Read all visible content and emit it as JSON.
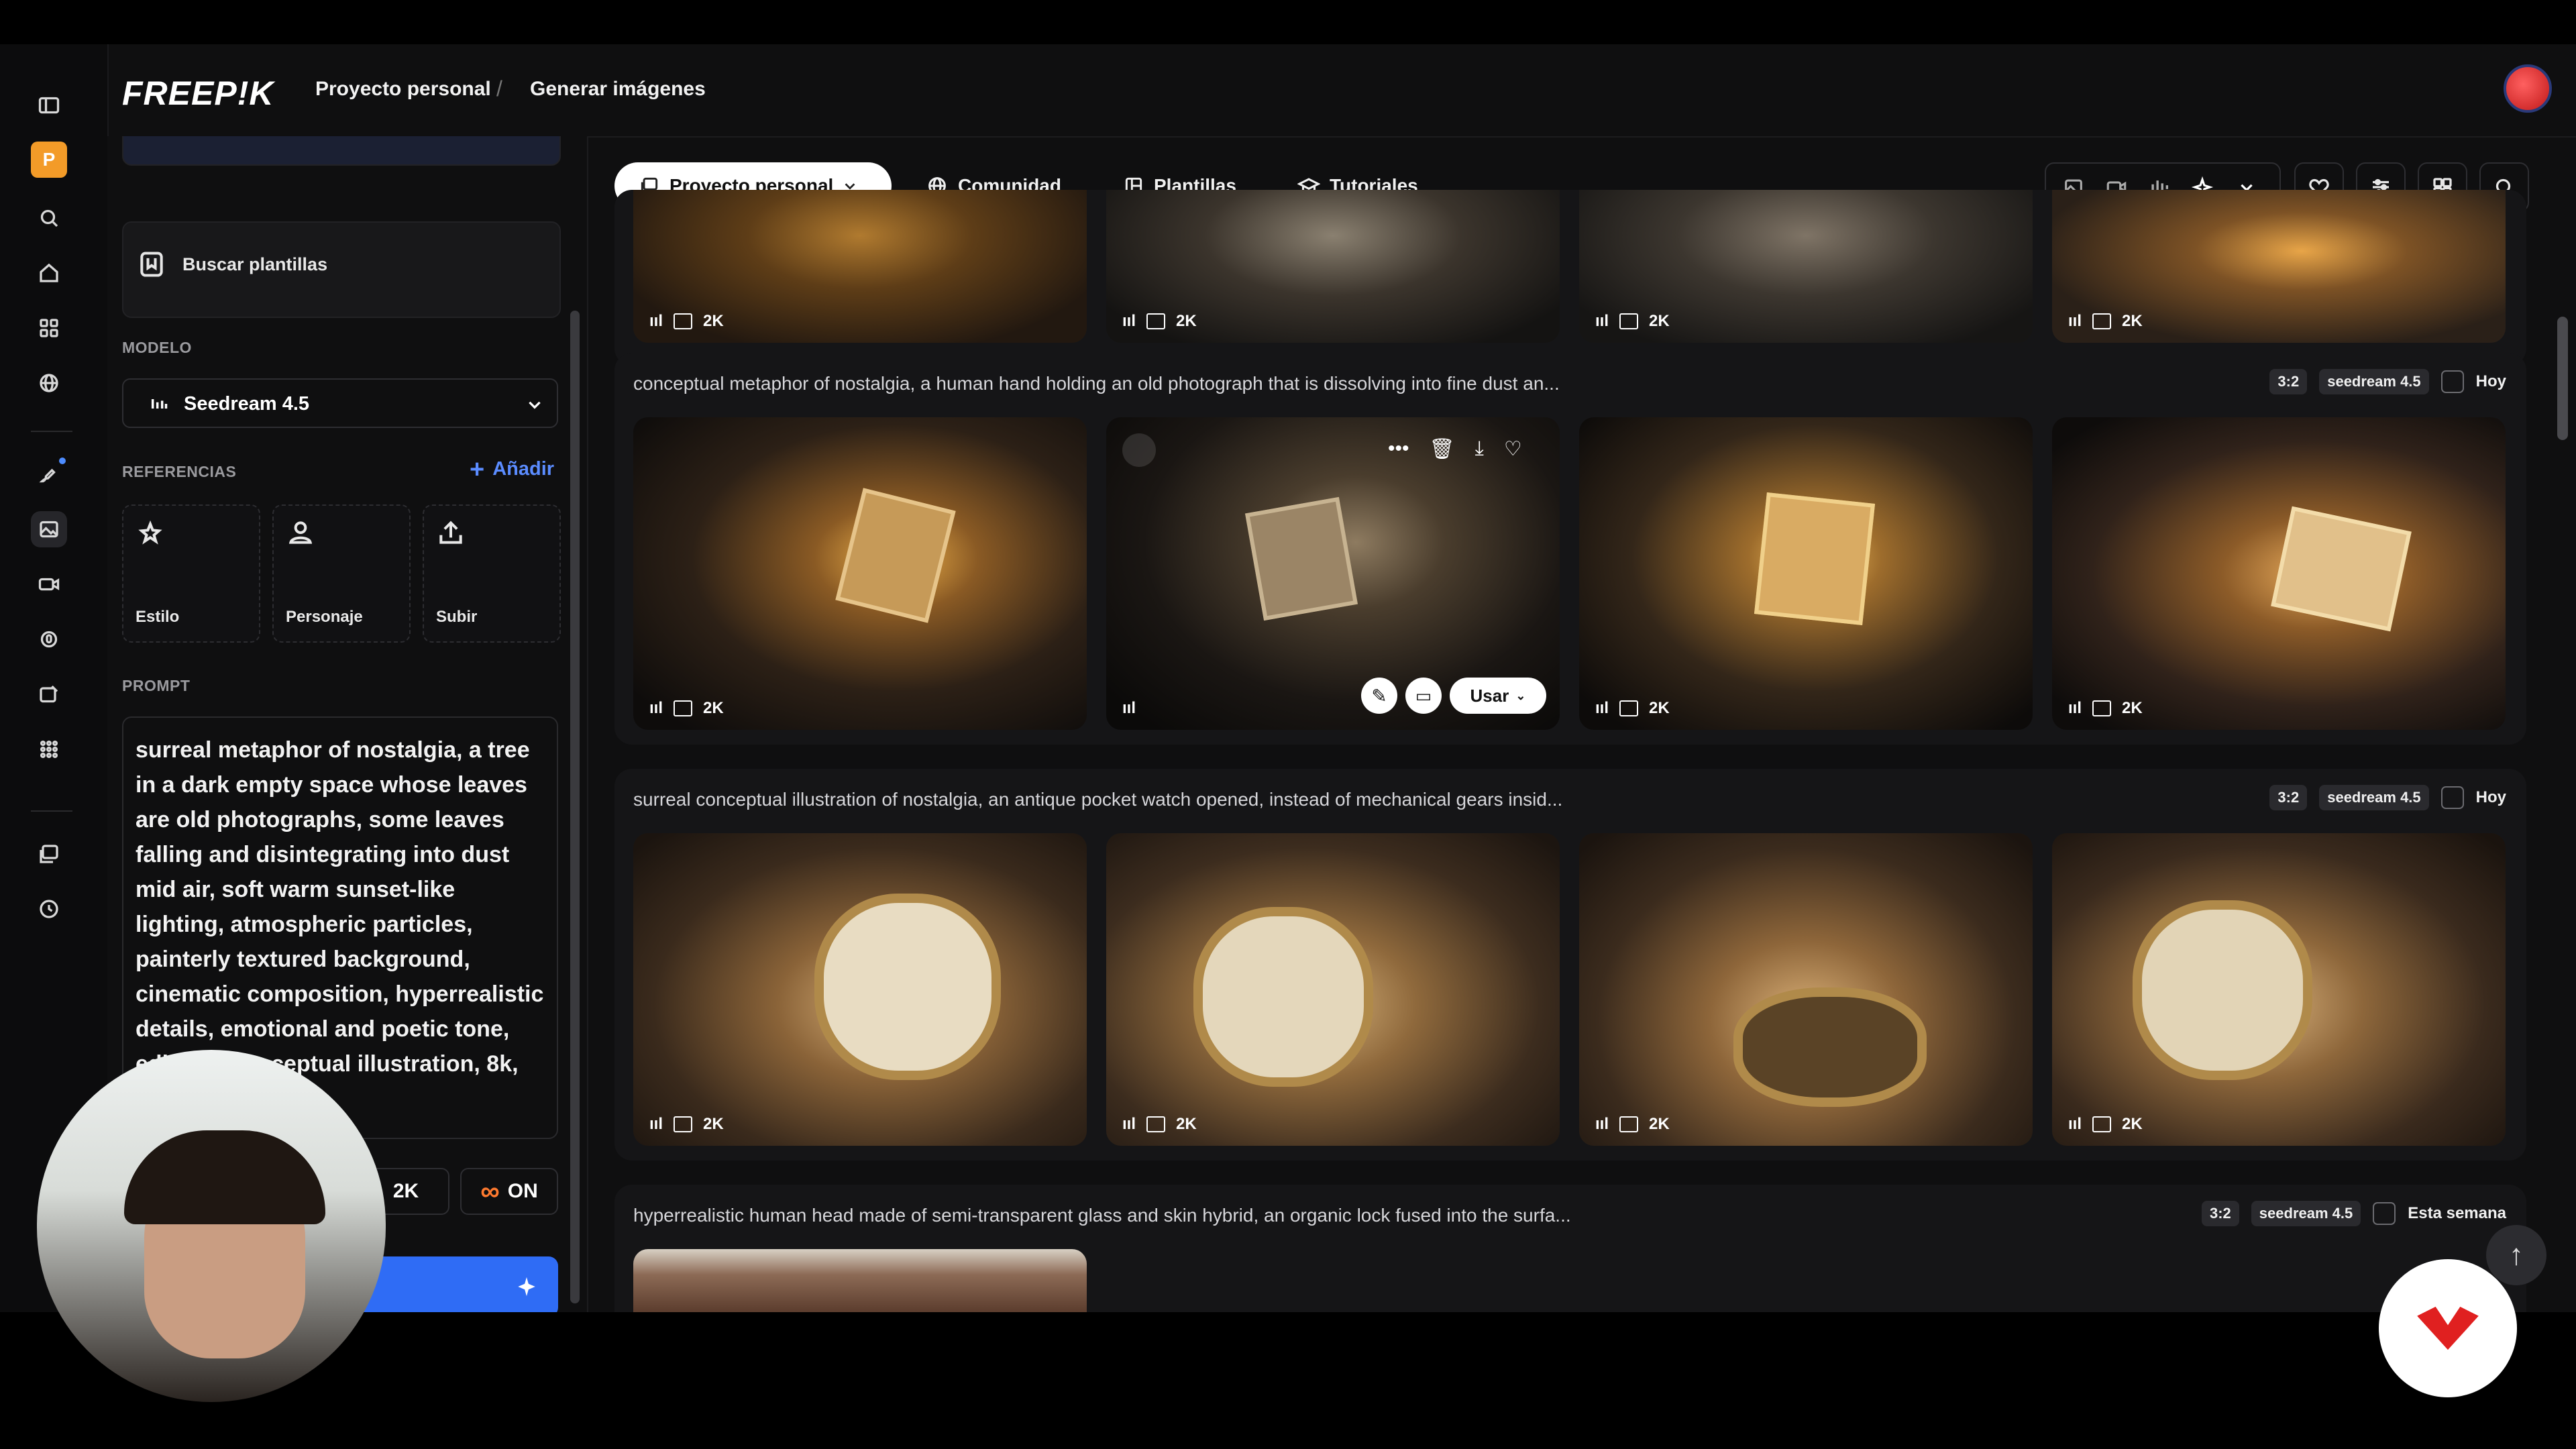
{
  "app": {
    "brand": "FREEP!K",
    "breadcrumb": [
      "Proyecto personal",
      "Generar imágenes"
    ],
    "breadcrumb_sep": "/"
  },
  "left_panel": {
    "templates_label": "Buscar plantillas",
    "model_section": "MODELO",
    "model_value": "Seedream 4.5",
    "refs_section": "REFERENCIAS",
    "refs_add": "Añadir",
    "refs": [
      "Estilo",
      "Personaje",
      "Subir"
    ],
    "prompt_section": "PROMPT",
    "prompt_text": "surreal metaphor of nostalgia, a tree in a dark empty space whose leaves are old photographs, some leaves falling and disintegrating into dust mid air, soft warm sunset-like lighting, atmospheric particles, painterly textured background, cinematic composition, hyperrealistic details, emotional and poetic tone, editorial conceptual illustration, 8k, no text",
    "resolution_label": "2K",
    "infinite_label": "ON"
  },
  "toolbar": {
    "project_label": "Proyecto personal",
    "tabs": [
      "Comunidad",
      "Plantillas",
      "Tutoriales"
    ]
  },
  "groups": [
    {
      "title": "",
      "badges": [
        "2K",
        "2K",
        "2K",
        "2K"
      ]
    },
    {
      "title": "conceptual metaphor of nostalgia, a human hand holding an old photograph that is dissolving into fine dust an...",
      "ratio": "3:2",
      "model": "seedream 4.5",
      "date": "Hoy",
      "badges": [
        "2K",
        "",
        "2K",
        "2K"
      ],
      "use_label": "Usar"
    },
    {
      "title": "surreal conceptual illustration of nostalgia, an antique pocket watch opened, instead of mechanical gears insid...",
      "ratio": "3:2",
      "model": "seedream 4.5",
      "date": "Hoy",
      "badges": [
        "2K",
        "2K",
        "2K",
        "2K"
      ]
    },
    {
      "title": "hyperrealistic human head made of semi-transparent glass and skin hybrid, an organic lock fused into the surfa...",
      "ratio": "3:2",
      "model": "seedream 4.5",
      "date": "Esta semana"
    }
  ],
  "colors": {
    "accent_blue": "#2f6cf5",
    "brand_orange": "#f39b28",
    "infinite_orange": "#ff7a2f",
    "badge_red": "#e02020"
  }
}
